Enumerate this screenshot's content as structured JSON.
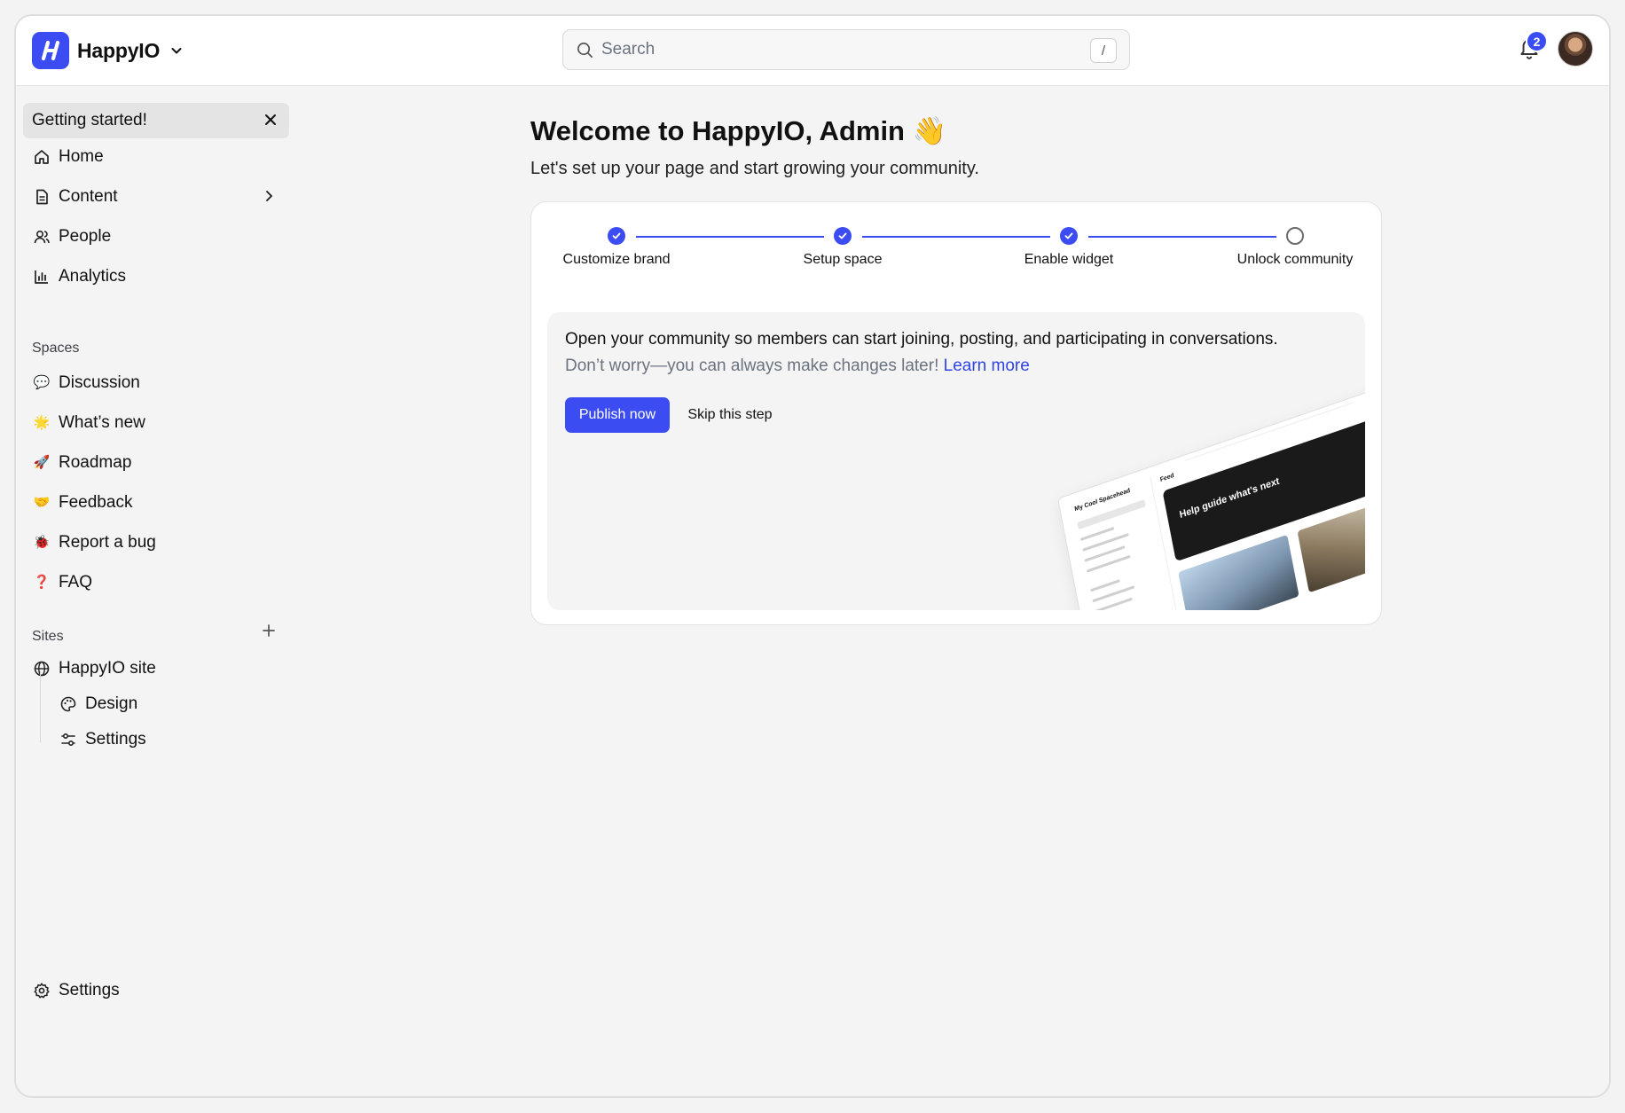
{
  "app": {
    "name": "HappyIO",
    "brand_color": "#3b4cf2"
  },
  "search": {
    "placeholder": "Search",
    "shortcut": "/"
  },
  "notifications": {
    "count": "2",
    "icon": "bell-icon"
  },
  "sidebar": {
    "getting_started": "Getting started!",
    "nav": [
      {
        "label": "Home",
        "icon": "home-icon"
      },
      {
        "label": "Content",
        "icon": "document-icon"
      },
      {
        "label": "People",
        "icon": "people-icon"
      },
      {
        "label": "Analytics",
        "icon": "bar-chart-icon"
      }
    ],
    "spaces_label": "Spaces",
    "spaces": [
      {
        "label": "Discussion",
        "emoji": "💬"
      },
      {
        "label": "What’s new",
        "emoji": "🌟"
      },
      {
        "label": "Roadmap",
        "emoji": "🚀"
      },
      {
        "label": "Feedback",
        "emoji": "🤝"
      },
      {
        "label": "Report a bug",
        "emoji": "🐞"
      },
      {
        "label": "FAQ",
        "emoji": "❓"
      }
    ],
    "sites_label": "Sites",
    "site": {
      "label": "HappyIO site",
      "icon": "globe-icon"
    },
    "site_children": [
      {
        "label": "Design",
        "icon": "palette-icon"
      },
      {
        "label": "Settings",
        "icon": "sliders-icon"
      }
    ],
    "settings": "Settings"
  },
  "main": {
    "title": "Welcome to HappyIO, Admin 👋",
    "subtitle": "Let's set up your page and start growing your community.",
    "steps": [
      {
        "label": "Customize brand",
        "done": true
      },
      {
        "label": "Setup space",
        "done": true
      },
      {
        "label": "Enable widget",
        "done": true
      },
      {
        "label": "Unlock community",
        "done": false
      }
    ],
    "headline": "Open your community so members can start joining, posting, and participating in conversations.",
    "note": "Don’t worry—you can always make changes later!",
    "learn_more": "Learn more",
    "publish": "Publish now",
    "skip": "Skip this step",
    "preview": {
      "space_name": "My Cool Spacehead",
      "feed": "Feed",
      "hero": "Help guide what's next"
    }
  }
}
